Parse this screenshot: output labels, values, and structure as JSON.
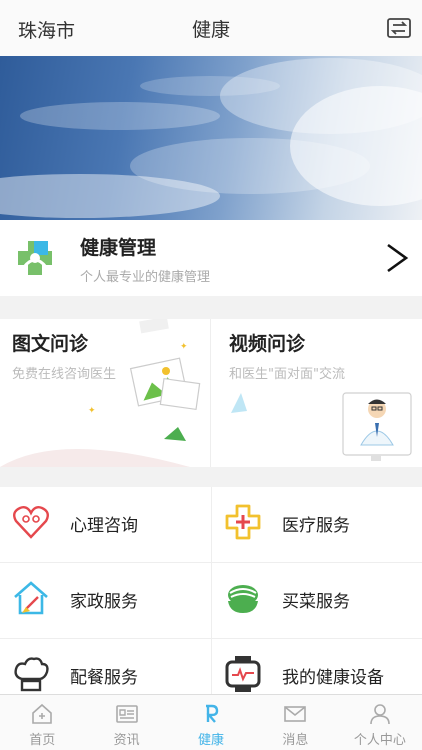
{
  "header": {
    "city": "珠海市",
    "title": "健康",
    "switch_icon": "switch-icon"
  },
  "health_management": {
    "title": "健康管理",
    "subtitle": "个人最专业的健康管理",
    "icon": "health-cross-icon"
  },
  "consultations": [
    {
      "title": "图文问诊",
      "subtitle": "免费在线咨询医生",
      "icon": "picture-chat-icon"
    },
    {
      "title": "视频问诊",
      "subtitle": "和医生\"面对面\"交流",
      "icon": "doctor-video-icon"
    }
  ],
  "services": [
    {
      "label": "心理咨询",
      "icon": "heart-mind-icon"
    },
    {
      "label": "医疗服务",
      "icon": "medical-cross-icon"
    },
    {
      "label": "家政服务",
      "icon": "house-broom-icon"
    },
    {
      "label": "买菜服务",
      "icon": "vegetable-bowl-icon"
    },
    {
      "label": "配餐服务",
      "icon": "chef-hat-icon"
    },
    {
      "label": "我的健康设备",
      "icon": "health-watch-icon"
    }
  ],
  "nav": [
    {
      "label": "首页",
      "icon": "home-icon",
      "active": false
    },
    {
      "label": "资讯",
      "icon": "news-icon",
      "active": false
    },
    {
      "label": "健康",
      "icon": "health-icon",
      "active": true
    },
    {
      "label": "消息",
      "icon": "mail-icon",
      "active": false
    },
    {
      "label": "个人中心",
      "icon": "user-icon",
      "active": false
    }
  ],
  "colors": {
    "accent": "#43b4e8",
    "health_green": "#78c06a",
    "health_blue": "#3cb8e6",
    "service_red": "#e5484d",
    "service_yellow": "#f2c12e",
    "service_green": "#4cae4f"
  }
}
